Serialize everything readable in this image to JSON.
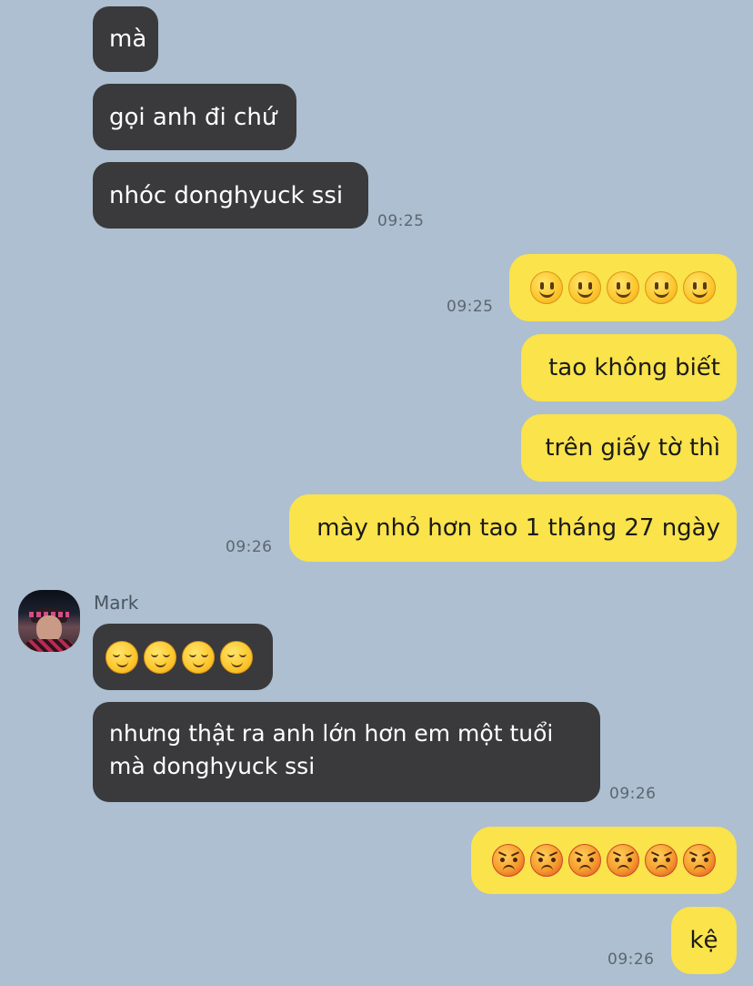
{
  "chat": {
    "contact_name": "Mark",
    "messages": [
      {
        "text": "mà"
      },
      {
        "text": "gọi anh đi chứ"
      },
      {
        "text": "nhóc donghyuck ssi",
        "time": "09:25"
      },
      {
        "emojis": [
          "slightly-smiling-face-emoji",
          "slightly-smiling-face-emoji",
          "slightly-smiling-face-emoji",
          "slightly-smiling-face-emoji",
          "slightly-smiling-face-emoji"
        ],
        "time": "09:25"
      },
      {
        "text": "tao không biết"
      },
      {
        "text": "trên giấy tờ thì"
      },
      {
        "text": "mày nhỏ hơn tao 1 tháng 27 ngày",
        "time": "09:26"
      },
      {
        "emojis": [
          "relieved-face-emoji",
          "relieved-face-emoji",
          "relieved-face-emoji",
          "relieved-face-emoji"
        ]
      },
      {
        "text": "nhưng thật ra anh lớn hơn em một tuổi mà donghyuck ssi",
        "time": "09:26"
      },
      {
        "emojis": [
          "angry-face-emoji",
          "angry-face-emoji",
          "angry-face-emoji",
          "angry-face-emoji",
          "angry-face-emoji",
          "angry-face-emoji"
        ]
      },
      {
        "text": "kệ",
        "time": "09:26"
      }
    ]
  },
  "colors": {
    "background": "#adbfd0",
    "incoming_bubble": "#3a3a3c",
    "outgoing_bubble": "#fae34b"
  }
}
